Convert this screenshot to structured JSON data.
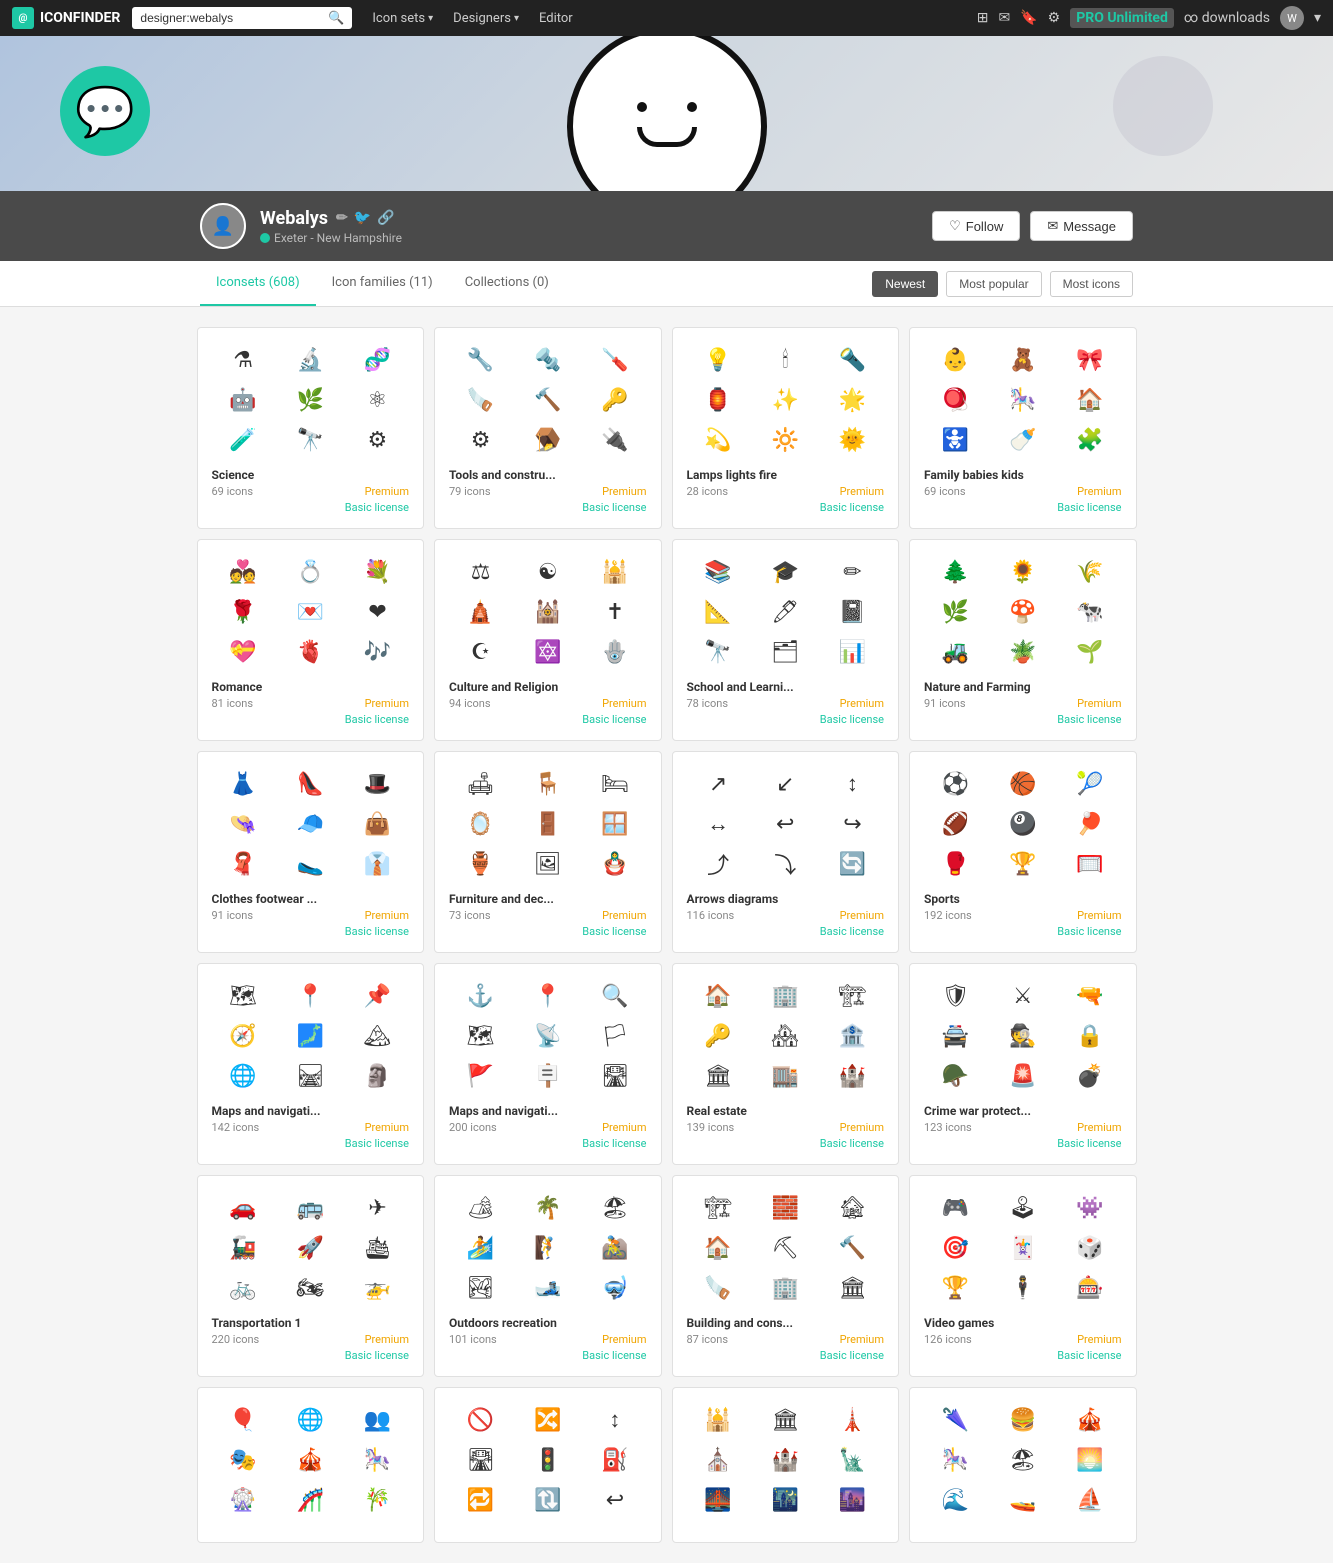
{
  "nav": {
    "logo_text": "ICONFINDER",
    "search_placeholder": "designer:webalys",
    "search_value": "designer:webalys",
    "links": [
      {
        "label": "Icon sets",
        "has_dropdown": true
      },
      {
        "label": "Designers",
        "has_dropdown": true
      },
      {
        "label": "Editor",
        "has_dropdown": false
      }
    ],
    "pro_label": "PRO Unlimited",
    "pro_sub": "∞ downloads"
  },
  "profile": {
    "name": "Webalys",
    "location": "Exeter - New Hampshire",
    "follow_label": "Follow",
    "message_label": "Message"
  },
  "tabs": {
    "items": [
      {
        "label": "Iconsets (608)",
        "active": true
      },
      {
        "label": "Icon families (11)",
        "active": false
      },
      {
        "label": "Collections (0)",
        "active": false
      }
    ],
    "sort_options": [
      {
        "label": "Newest",
        "active": true
      },
      {
        "label": "Most popular",
        "active": false
      },
      {
        "label": "Most icons",
        "active": false
      }
    ]
  },
  "cards": [
    {
      "title": "Science",
      "count": "69 icons",
      "license": "Basic license",
      "badge": "Premium",
      "icons": [
        "⚗",
        "🔬",
        "🧬",
        "🤖",
        "🌿",
        "⚛",
        "🧪",
        "🔭",
        "⚙"
      ]
    },
    {
      "title": "Tools and constru...",
      "count": "79 icons",
      "license": "Basic license",
      "badge": "Premium",
      "icons": [
        "🔧",
        "🔩",
        "🪛",
        "🪚",
        "🔨",
        "🔑",
        "⚙",
        "🪤",
        "🔌"
      ]
    },
    {
      "title": "Lamps lights fire",
      "count": "28 icons",
      "license": "Basic license",
      "badge": "Premium",
      "icons": [
        "💡",
        "🕯",
        "🔦",
        "🏮",
        "✨",
        "🌟",
        "💫",
        "🔆",
        "🌞"
      ]
    },
    {
      "title": "Family babies kids",
      "count": "69 icons",
      "license": "Basic license",
      "badge": "Premium",
      "icons": [
        "👶",
        "🧸",
        "🎀",
        "🪀",
        "🎠",
        "🏠",
        "🚼",
        "🍼",
        "🧩"
      ]
    },
    {
      "title": "Romance",
      "count": "81 icons",
      "license": "Basic license",
      "badge": "Premium",
      "icons": [
        "💑",
        "💍",
        "💐",
        "🌹",
        "💌",
        "❤",
        "💝",
        "🫀",
        "🎶"
      ]
    },
    {
      "title": "Culture and Religion",
      "count": "94 icons",
      "license": "Basic license",
      "badge": "Premium",
      "icons": [
        "⚖",
        "☯",
        "🕌",
        "🛕",
        "🕍",
        "✝",
        "☪",
        "🔯",
        "🪬"
      ]
    },
    {
      "title": "School and Learni...",
      "count": "78 icons",
      "license": "Basic license",
      "badge": "Premium",
      "icons": [
        "📚",
        "🎓",
        "✏",
        "📐",
        "🖊",
        "📓",
        "🔭",
        "🗂",
        "📊"
      ]
    },
    {
      "title": "Nature and Farming",
      "count": "91 icons",
      "license": "Basic license",
      "badge": "Premium",
      "icons": [
        "🌲",
        "🌻",
        "🌾",
        "🌿",
        "🍄",
        "🐄",
        "🚜",
        "🪴",
        "🌱"
      ]
    },
    {
      "title": "Clothes footwear ...",
      "count": "91 icons",
      "license": "Basic license",
      "badge": "Premium",
      "icons": [
        "👗",
        "👠",
        "🎩",
        "👒",
        "🧢",
        "👜",
        "🧣",
        "🥿",
        "👔"
      ]
    },
    {
      "title": "Furniture and dec...",
      "count": "73 icons",
      "license": "Basic license",
      "badge": "Premium",
      "icons": [
        "🛋",
        "🪑",
        "🛏",
        "🪞",
        "🚪",
        "🪟",
        "🏺",
        "🖼",
        "🪆"
      ]
    },
    {
      "title": "Arrows diagrams",
      "count": "116 icons",
      "license": "Basic license",
      "badge": "Premium",
      "icons": [
        "↗",
        "↙",
        "↕",
        "↔",
        "↩",
        "↪",
        "⤴",
        "⤵",
        "🔄"
      ]
    },
    {
      "title": "Sports",
      "count": "192 icons",
      "license": "Basic license",
      "badge": "Premium",
      "icons": [
        "⚽",
        "🏀",
        "🎾",
        "🏈",
        "🎱",
        "🏓",
        "🥊",
        "🏆",
        "🥅"
      ]
    },
    {
      "title": "Maps and navigati...",
      "count": "142 icons",
      "license": "Basic license",
      "badge": "Premium",
      "icons": [
        "🗺",
        "📍",
        "📌",
        "🧭",
        "🗾",
        "🏔",
        "🌐",
        "🛤",
        "🗿"
      ]
    },
    {
      "title": "Maps and navigati...",
      "count": "200 icons",
      "license": "Basic license",
      "badge": "Premium",
      "icons": [
        "⚓",
        "📍",
        "🔍",
        "🗺",
        "📡",
        "🏳",
        "🚩",
        "🪧",
        "🛣"
      ]
    },
    {
      "title": "Real estate",
      "count": "139 icons",
      "license": "Basic license",
      "badge": "Premium",
      "icons": [
        "🏠",
        "🏢",
        "🏗",
        "🔑",
        "🏘",
        "🏦",
        "🏛",
        "🏬",
        "🏰"
      ]
    },
    {
      "title": "Crime war protect...",
      "count": "123 icons",
      "license": "Basic license",
      "badge": "Premium",
      "icons": [
        "🛡",
        "⚔",
        "🔫",
        "🚔",
        "🕵",
        "🔒",
        "🪖",
        "🚨",
        "💣"
      ]
    },
    {
      "title": "Transportation 1",
      "count": "220 icons",
      "license": "Basic license",
      "badge": "Premium",
      "icons": [
        "🚗",
        "🚌",
        "✈",
        "🚂",
        "🚀",
        "🛳",
        "🚲",
        "🏍",
        "🚁"
      ]
    },
    {
      "title": "Outdoors recreation",
      "count": "101 icons",
      "license": "Basic license",
      "badge": "Premium",
      "icons": [
        "🏕",
        "🌴",
        "🏖",
        "🏄",
        "🧗",
        "🚵",
        "🏞",
        "🎿",
        "🤿"
      ]
    },
    {
      "title": "Building and cons...",
      "count": "87 icons",
      "license": "Basic license",
      "badge": "Premium",
      "icons": [
        "🏗",
        "🧱",
        "🏚",
        "🏠",
        "⛏",
        "🔨",
        "🪚",
        "🏢",
        "🏛"
      ]
    },
    {
      "title": "Video games",
      "count": "126 icons",
      "license": "Basic license",
      "badge": "Premium",
      "icons": [
        "🎮",
        "🕹",
        "👾",
        "🎯",
        "🃏",
        "🎲",
        "🏆",
        "🕴",
        "🎰"
      ]
    },
    {
      "title": "",
      "count": "",
      "license": "",
      "badge": "",
      "icons": [
        "🎈",
        "🌐",
        "👥",
        "🎭",
        "🎪",
        "🎠",
        "🎡",
        "🎢",
        "🎋"
      ],
      "partial": true
    },
    {
      "title": "",
      "count": "",
      "license": "",
      "badge": "",
      "icons": [
        "🚫",
        "🔀",
        "↕",
        "🛣",
        "🚦",
        "⛽",
        "🔁",
        "🔃",
        "↩"
      ],
      "partial": true
    },
    {
      "title": "",
      "count": "",
      "license": "",
      "badge": "",
      "icons": [
        "🕌",
        "🏛",
        "🗼",
        "⛪",
        "🏰",
        "🗽",
        "🌉",
        "🌃",
        "🌆"
      ],
      "partial": true
    },
    {
      "title": "",
      "count": "",
      "license": "",
      "badge": "",
      "icons": [
        "🌂",
        "🍔",
        "🎪",
        "🎠",
        "🏖",
        "🌅",
        "🌊",
        "🚤",
        "⛵"
      ],
      "partial": true
    }
  ]
}
